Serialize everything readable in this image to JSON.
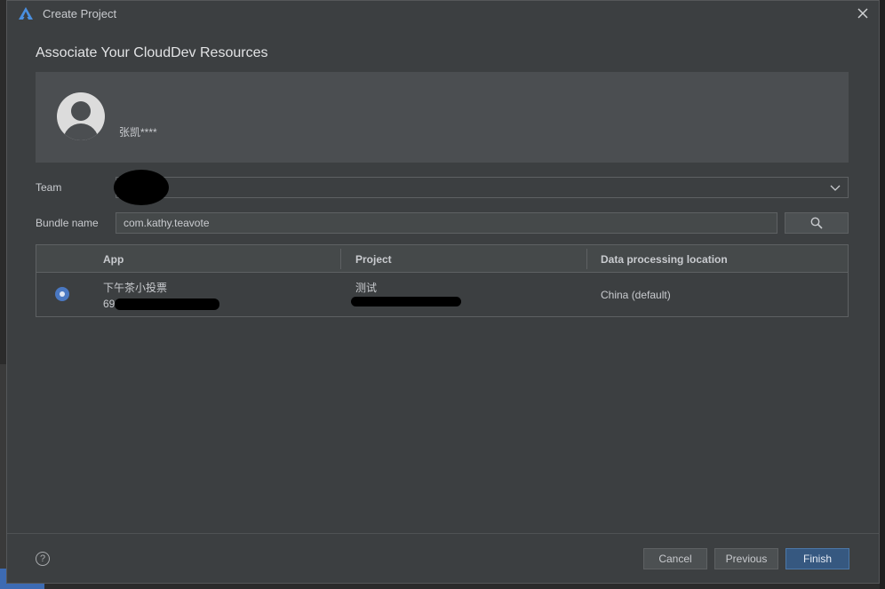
{
  "window": {
    "title": "Create Project"
  },
  "heading": "Associate Your CloudDev Resources",
  "account": {
    "name": "张凯****"
  },
  "form": {
    "team_label": "Team",
    "bundle_label": "Bundle name",
    "bundle_value": "com.kathy.teavote"
  },
  "table": {
    "headers": [
      "App",
      "Project",
      "Data processing location"
    ],
    "rows": [
      {
        "app_name": "下午茶小投票",
        "app_id_prefix": "69",
        "project": "测试",
        "location": "China (default)",
        "selected": true
      }
    ]
  },
  "buttons": {
    "cancel": "Cancel",
    "previous": "Previous",
    "finish": "Finish"
  },
  "help": "?",
  "colors": {
    "accent": "#365880",
    "radio": "#4a78c2",
    "card": "#4b4e51"
  }
}
